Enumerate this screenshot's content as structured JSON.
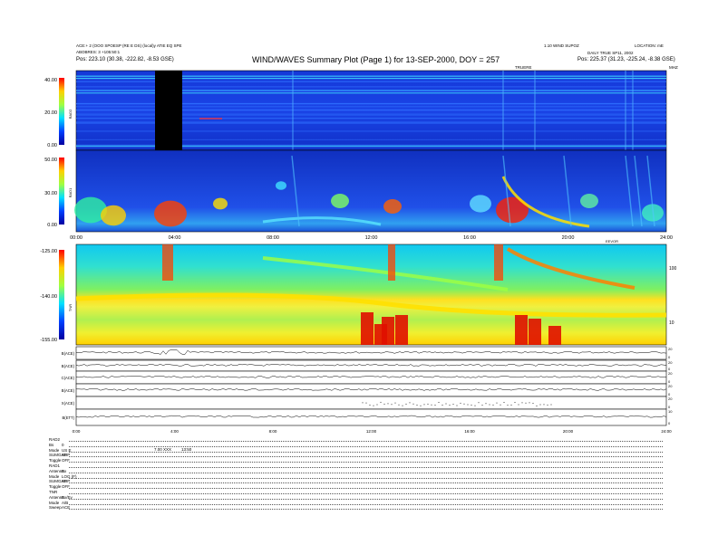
{
  "header": {
    "top_left_line1": "ACE:+ 2 (OOO SPOESP (RE E DS) (local)y ATIE EQ SPE",
    "top_left_line2": "ABOBRES: 3 +105:50:1",
    "pos_left": "Pos:   223.10 (30.38, -222.82, -8.53 GSE)",
    "title": "WIND/WAVES Summary Plot (Page 1) for 13-SEP-2000, DOY = 257",
    "top_right_line1": "1.10 WIND SUPOZ",
    "top_right_line2": "LOCATION: mE",
    "top_right_line3": "DAILY TRUE SP11, 2002",
    "pos_right": "Pos:   225.37 (31.23, -225.24, -8.38 GSE)",
    "time_label": "TRUERE",
    "right_corner": "MHZ"
  },
  "chart_data": [
    {
      "type": "heatmap",
      "name": "RAD2",
      "ylabel": "RAD2",
      "yticks": [
        "40.00",
        "20.00",
        "0.00"
      ],
      "ylim": [
        0,
        40
      ],
      "xlim": [
        0,
        24
      ]
    },
    {
      "type": "heatmap",
      "name": "RAD1",
      "ylabel": "RAD1",
      "yticks": [
        "50.00",
        "30.00",
        "0.00"
      ],
      "ylim": [
        0,
        50
      ],
      "xlim": [
        0,
        24
      ],
      "xticks": [
        "00:00",
        "04:00",
        "08:00",
        "12:00",
        "16:00",
        "20:00",
        "24:00"
      ],
      "xunit": "EEVOR"
    },
    {
      "type": "heatmap",
      "name": "TNR",
      "ylabel": "TNR",
      "yticks": [
        "-125.00",
        "-140.00",
        "-155.00"
      ],
      "ylim": [
        -155,
        -125
      ],
      "right_ticks": [
        "100",
        "10"
      ],
      "xlim": [
        0,
        24
      ]
    },
    {
      "type": "line",
      "name": "ACE panels",
      "panel_labels": [
        "B(ACE)",
        "B(ACE)",
        "C(ACE)",
        "B(ACE)",
        "X(ACE)",
        "B(ETT)"
      ],
      "right_ticks": [
        [
          "20",
          "0"
        ],
        [
          "20",
          "0"
        ],
        [
          "20",
          "0"
        ],
        [
          "20",
          "0"
        ],
        [
          "20",
          "0"
        ],
        [
          "10",
          "0"
        ]
      ],
      "xticks": [
        "0:00",
        "4:00",
        "8:00",
        "12:00",
        "16:00",
        "20:00",
        "24:00"
      ],
      "xlim": [
        0,
        24
      ]
    }
  ],
  "footer": {
    "rows": [
      {
        "label": "RAD2",
        "value": ""
      },
      {
        "label": "Bs",
        "value": "0"
      },
      {
        "label": "Mode",
        "value": "US E"
      },
      {
        "label": "SUMGAP",
        "value": "SUP"
      },
      {
        "label": "Toggle",
        "value": "OFF"
      },
      {
        "label": "RAD1",
        "value": ""
      },
      {
        "label": "Antenna",
        "value": "Ex"
      },
      {
        "label": "Mode",
        "value": "LOG (F)"
      },
      {
        "label": "SUMGAP",
        "value": "SUP"
      },
      {
        "label": "Toggle",
        "value": "OFF"
      },
      {
        "label": "TNR",
        "value": ""
      },
      {
        "label": "Antenna",
        "value": "Ex/Ey"
      },
      {
        "label": "Mode",
        "value": "A/B"
      },
      {
        "label": "Sweep",
        "value": "ACE"
      }
    ],
    "note1": "7.00 XXX",
    "note2": "13:50"
  }
}
